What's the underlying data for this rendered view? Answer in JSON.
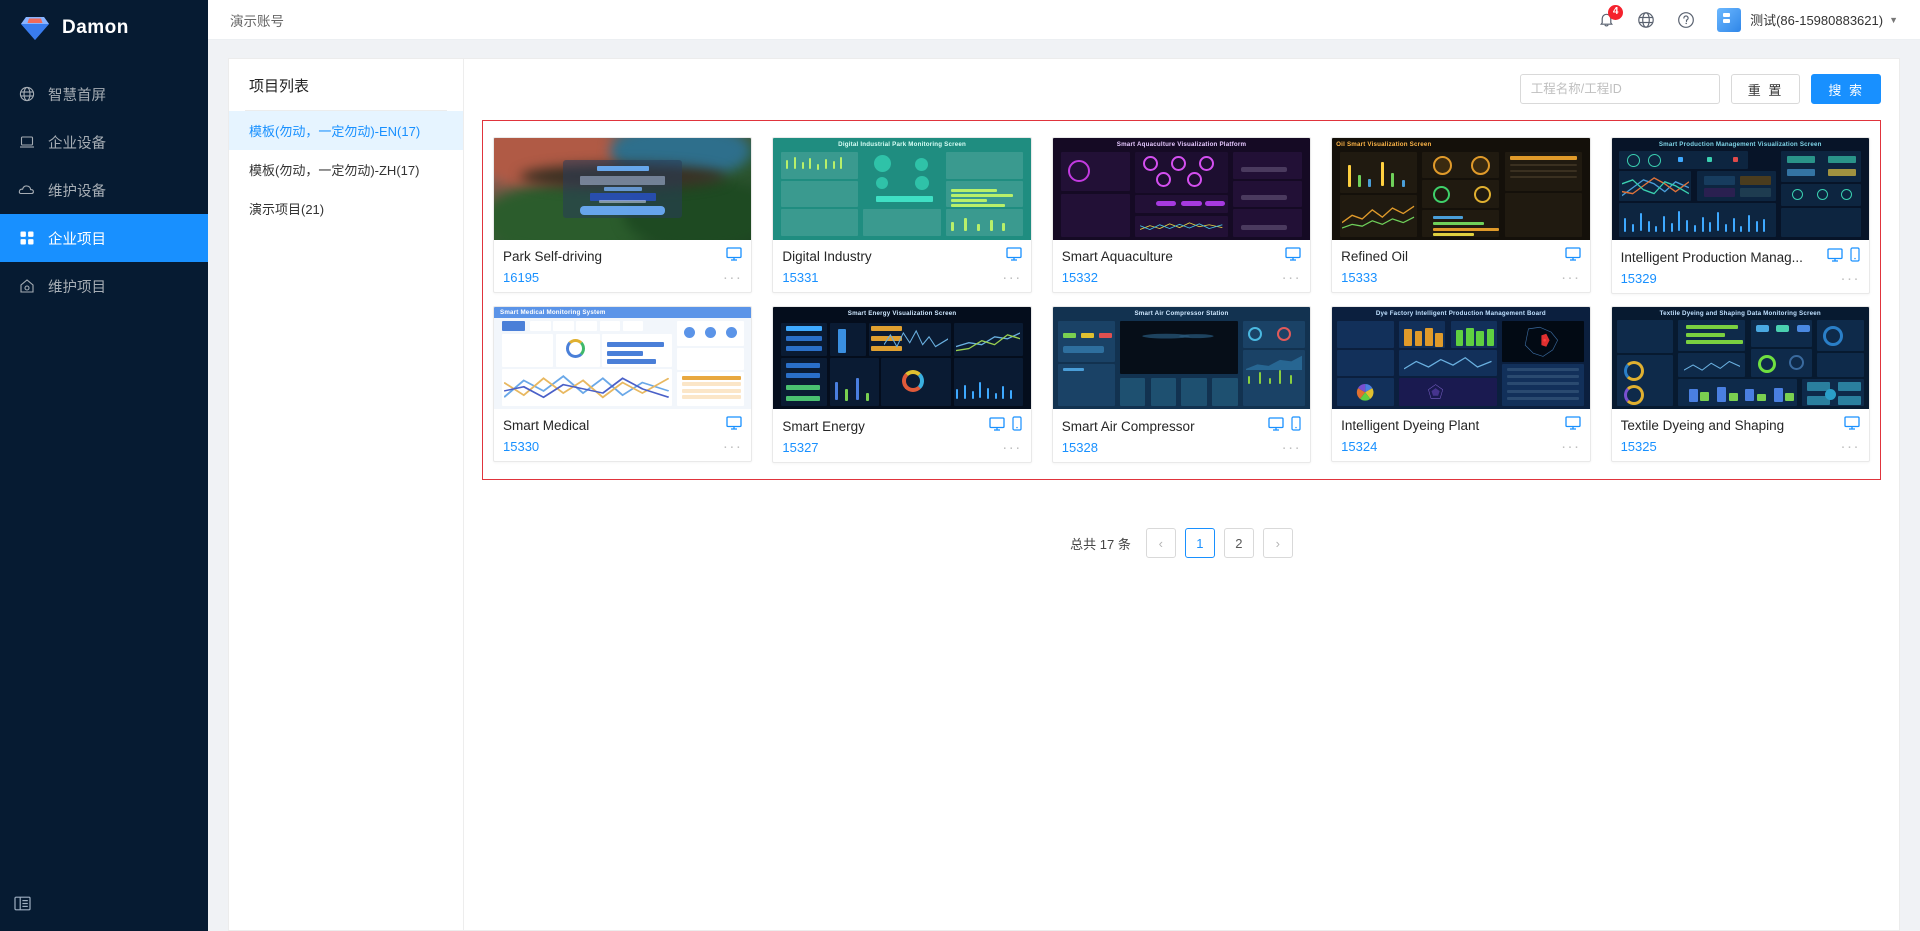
{
  "brand": {
    "name": "Damon",
    "logo_icon": "diamond-icon"
  },
  "sidebar": {
    "items": [
      {
        "label": "智慧首屏",
        "icon": "globe-icon",
        "active": false
      },
      {
        "label": "企业设备",
        "icon": "laptop-icon",
        "active": false
      },
      {
        "label": "维护设备",
        "icon": "cloud-icon",
        "active": false
      },
      {
        "label": "企业项目",
        "icon": "appstore-icon",
        "active": true
      },
      {
        "label": "维护项目",
        "icon": "home-icon",
        "active": false
      }
    ],
    "collapse_icon": "menu-fold-icon"
  },
  "topbar": {
    "account_label": "演示账号",
    "bell_icon": "bell-icon",
    "bell_badge": "4",
    "globe_icon": "globe-icon",
    "help_icon": "question-circle-icon",
    "company_icon": "building-icon",
    "user_name": "测试(86-15980883621)",
    "caret_icon": "chevron-down-icon"
  },
  "project_panel": {
    "title": "项目列表",
    "items": [
      {
        "label": "模板(勿动，一定勿动)-EN(17)",
        "active": true
      },
      {
        "label": "模板(勿动，一定勿动)-ZH(17)",
        "active": false
      },
      {
        "label": "演示项目(21)",
        "active": false
      }
    ]
  },
  "search": {
    "placeholder": "工程名称/工程ID",
    "value": "",
    "reset_label": "重 置",
    "search_label": "搜 索"
  },
  "cards": [
    {
      "title": "Park Self-driving",
      "id": "16195",
      "platforms": [
        "desktop"
      ],
      "thumb": "park",
      "dots": "···"
    },
    {
      "title": "Digital Industry",
      "id": "15331",
      "platforms": [
        "desktop"
      ],
      "thumb": "teal",
      "dots": "···",
      "screen_title": "Digital Industrial Park Monitoring Screen"
    },
    {
      "title": "Smart Aquaculture",
      "id": "15332",
      "platforms": [
        "desktop"
      ],
      "thumb": "purple",
      "dots": "···",
      "screen_title": "Smart Aquaculture Visualization Platform"
    },
    {
      "title": "Refined Oil",
      "id": "15333",
      "platforms": [
        "desktop"
      ],
      "thumb": "amber",
      "dots": "···",
      "screen_title": "Oil Smart Visualization Screen"
    },
    {
      "title": "Intelligent Production Manag...",
      "id": "15329",
      "platforms": [
        "desktop",
        "mobile"
      ],
      "thumb": "navyblue",
      "dots": "···",
      "screen_title": "Smart Production Management Visualization Screen"
    },
    {
      "title": "Smart Medical",
      "id": "15330",
      "platforms": [
        "desktop"
      ],
      "thumb": "light",
      "dots": "···",
      "screen_title": "Smart Medical Monitoring System"
    },
    {
      "title": "Smart Energy",
      "id": "15327",
      "platforms": [
        "desktop",
        "mobile"
      ],
      "thumb": "energy",
      "dots": "···",
      "screen_title": "Smart Energy Visualization Screen"
    },
    {
      "title": "Smart Air Compressor",
      "id": "15328",
      "platforms": [
        "desktop",
        "mobile"
      ],
      "thumb": "compressor",
      "dots": "···",
      "screen_title": "Smart Air Compressor Station"
    },
    {
      "title": "Intelligent Dyeing Plant",
      "id": "15324",
      "platforms": [
        "desktop"
      ],
      "thumb": "dyeing",
      "dots": "···",
      "screen_title": "Dye Factory Intelligent Production Management Board"
    },
    {
      "title": "Textile Dyeing and Shaping",
      "id": "15325",
      "platforms": [
        "desktop"
      ],
      "thumb": "textile",
      "dots": "···",
      "screen_title": "Textile Dyeing and Shaping Data Monitoring Screen"
    }
  ],
  "pagination": {
    "total_label": "总共 17 条",
    "prev": "‹",
    "pages": [
      "1",
      "2"
    ],
    "current": "1",
    "next": "›"
  },
  "colors": {
    "accent": "#1890ff",
    "sidebar_bg": "#061b32",
    "frame_border": "#e0343c",
    "badge": "#f5222d"
  }
}
